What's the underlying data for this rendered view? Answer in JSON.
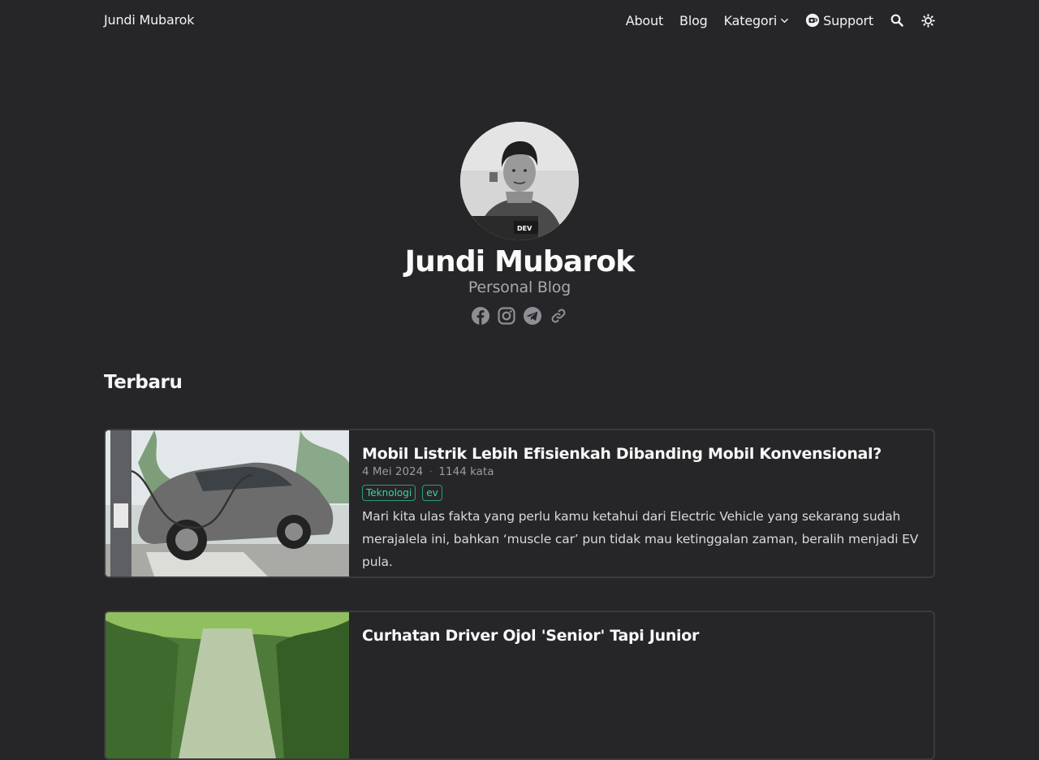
{
  "header": {
    "brand": "Jundi Mubarok",
    "nav": {
      "about": "About",
      "blog": "Blog",
      "kategori": "Kategori",
      "support": "Support"
    }
  },
  "hero": {
    "name": "Jundi Mubarok",
    "subtitle": "Personal Blog",
    "socials": [
      "facebook-icon",
      "instagram-icon",
      "telegram-icon",
      "link-icon"
    ]
  },
  "section": {
    "title": "Terbaru"
  },
  "posts": [
    {
      "title": "Mobil Listrik Lebih Efisienkah Dibanding Mobil Konvensional?",
      "date": "4 Mei 2024",
      "separator": "·",
      "words": "1144 kata",
      "tags": [
        "Teknologi",
        "ev"
      ],
      "excerpt": "Mari kita ulas fakta yang perlu kamu ketahui dari Electric Vehicle yang sekarang sudah merajalela ini, bahkan ‘muscle car’ pun tidak mau ketinggalan zaman, beralih menjadi EV pula."
    },
    {
      "title": "Curhatan Driver Ojol 'Senior' Tapi Junior"
    }
  ],
  "colors": {
    "background": "#262528",
    "accent": "#3fd39b",
    "muted": "#a8a8ad"
  }
}
